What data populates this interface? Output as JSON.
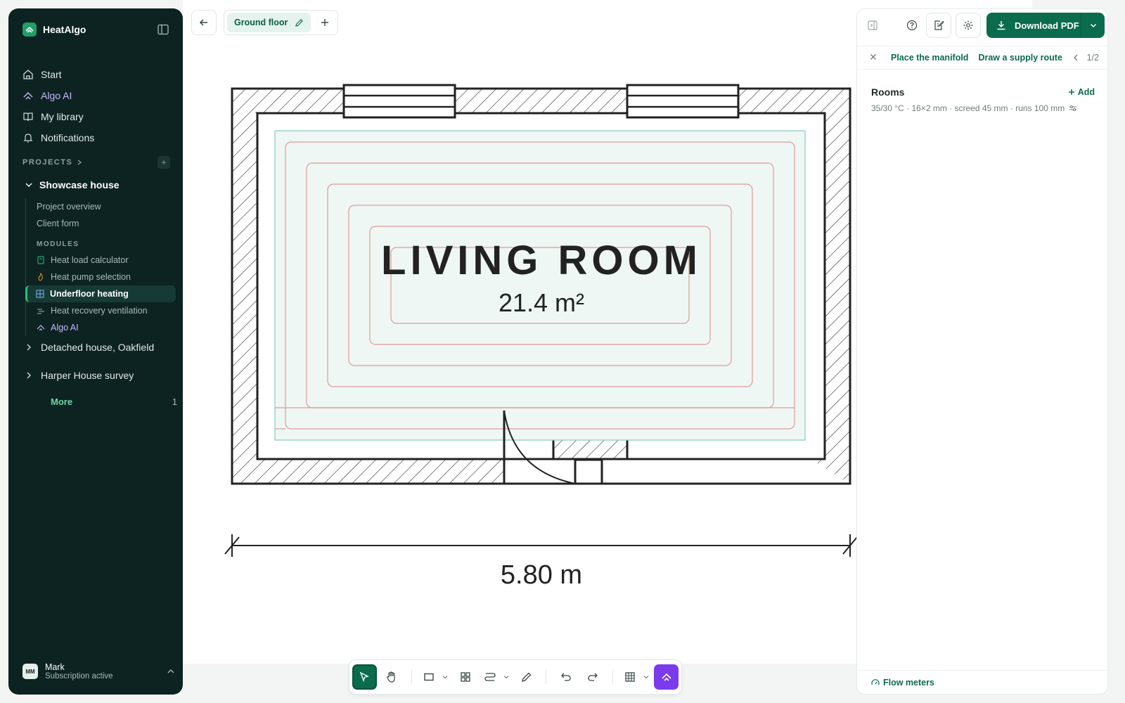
{
  "app": {
    "name": "HeatAlgo"
  },
  "nav": {
    "start": "Start",
    "algo_ai": "Algo AI",
    "library": "My library",
    "notifications": "Notifications"
  },
  "projects": {
    "label": "PROJECTS",
    "open_project": {
      "name": "Showcase house",
      "items": [
        "Project overview",
        "Client form"
      ],
      "modules_label": "MODULES",
      "modules": [
        {
          "label": "Heat load calculator",
          "icon": "calculator-icon"
        },
        {
          "label": "Heat pump selection",
          "icon": "flame-icon"
        },
        {
          "label": "Underfloor heating",
          "icon": "grid-icon",
          "active": true
        },
        {
          "label": "Heat recovery ventilation",
          "icon": "fan-icon"
        },
        {
          "label": "Algo AI",
          "icon": "ai-icon"
        }
      ]
    },
    "other": [
      "Detached house, Oakfield",
      "Harper House survey"
    ],
    "more_label": "More",
    "more_count": "1"
  },
  "user": {
    "initials": "MM",
    "name": "Mark",
    "status": "Subscription active"
  },
  "canvas": {
    "floor_tab": "Ground floor",
    "room_name": "LIVING ROOM",
    "room_area": "21.4 m²",
    "dimension": "5.80 m"
  },
  "panel": {
    "download_label": "Download PDF",
    "step_1": "Place the manifold",
    "step_2": "Draw a supply route",
    "pager": "1/2",
    "rooms_title": "Rooms",
    "add_label": "Add",
    "rooms_meta": "35/30 °C · 16×2 mm · screed 45 mm · runs 100 mm",
    "footer_link": "Flow meters"
  },
  "colors": {
    "brand": "#0b6b4d",
    "sidebar": "#0c2321",
    "ai": "#7c3aed",
    "pipe": "#e3989a",
    "zone": "#eef7f4"
  }
}
